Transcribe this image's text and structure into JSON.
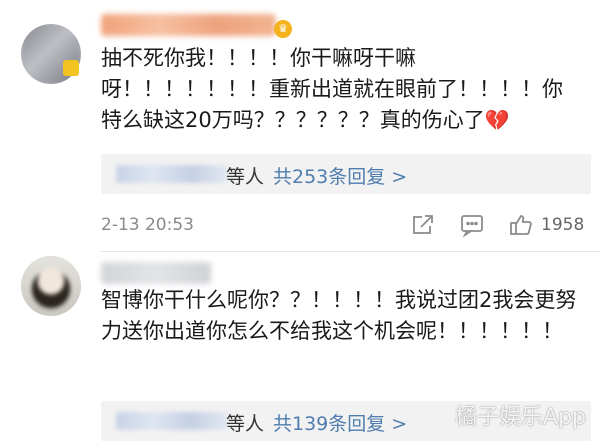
{
  "comments": [
    {
      "text": "抽不死你我！！！！你干嘛呀干嘛呀！！！！！！！重新出道就在眼前了！！！！你特么缺这20万吗？？？？？？真的伤心了",
      "emoji": "💔",
      "replies_suffix": "等人",
      "replies_link": "共253条回复 >",
      "timestamp": "2-13 20:53",
      "likes": "1958"
    },
    {
      "text": "智博你干什么呢你？？！！！！我说过团2我会更努力送你出道你怎么不给我这个机会呢！！！！！！",
      "replies_suffix": "等人",
      "replies_link": "共139条回复 >"
    }
  ],
  "watermark": "橘子娱乐App",
  "colors": {
    "link": "#507daf",
    "heart": "#e0323c",
    "reply_bg": "#f2f2f2"
  }
}
